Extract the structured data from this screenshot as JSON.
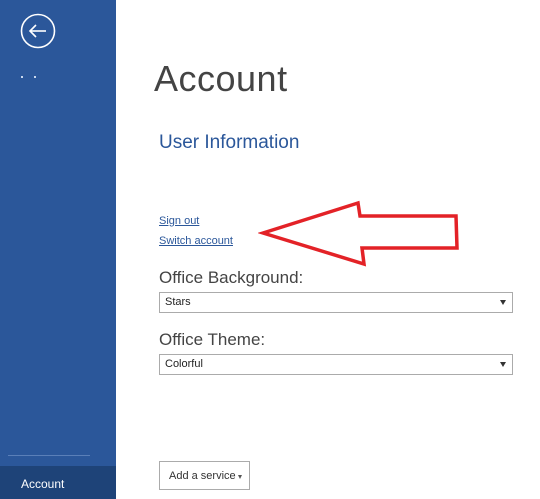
{
  "sidebar": {
    "back_icon": "back-arrow-icon",
    "active_item": "Account"
  },
  "main": {
    "title": "Account",
    "section_title": "User Information",
    "links": {
      "sign_out": "Sign out",
      "switch_account": "Switch account"
    },
    "office_background": {
      "label": "Office Background:",
      "value": "Stars"
    },
    "office_theme": {
      "label": "Office Theme:",
      "value": "Colorful"
    },
    "add_service_label": "Add a service"
  },
  "colors": {
    "sidebar": "#2b579a",
    "sidebar_active": "#1e4378",
    "accent": "#2b579a",
    "annotation": "#e32227"
  }
}
